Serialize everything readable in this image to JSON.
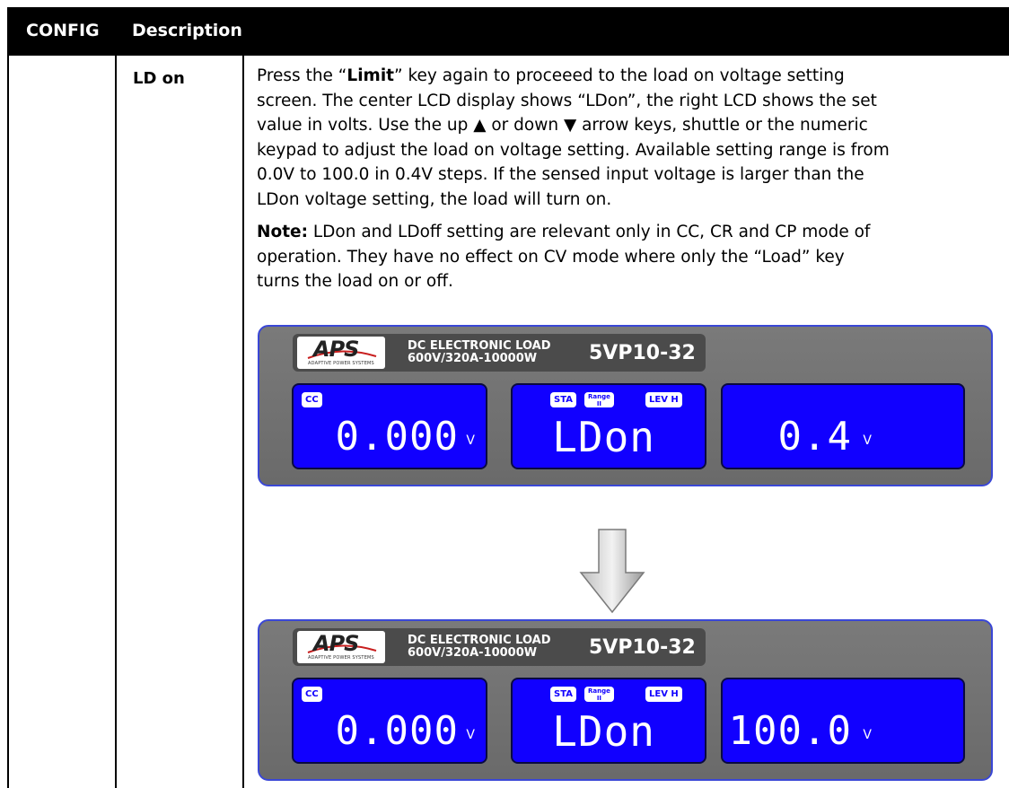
{
  "header": {
    "col1": "CONFIG",
    "col2": "Description"
  },
  "row": {
    "key": "LD on",
    "paragraph1_lines": [
      "Press the “Limit” key again to proceeed to the load on voltage setting",
      "screen. The center LCD display shows “LDon”, the right LCD shows the set",
      "value in volts. Use the up ▲ or down ▼ arrow keys, shuttle or the numeric",
      "keypad  to adjust the load on voltage setting. Available setting range is from",
      "0.0V to 100.0 in 0.4V steps.  If the sensed input voltage is larger than the",
      "LDon voltage setting, the load will turn on."
    ],
    "note_label": "Note:",
    "note_lines": [
      " LDon and LDoff setting are relevant only in CC, CR and CP mode of",
      "operation. They have no effect on CV mode where only the “Load” key",
      "turns the load on or off."
    ]
  },
  "panel_brand": {
    "logo_text": "APS",
    "logo_subtext": "ADAPTIVE POWER SYSTEMS",
    "product_line1": "DC ELECTRONIC LOAD",
    "product_line2": "600V/320A-10000W",
    "model": "5VP10-32"
  },
  "panels": [
    {
      "mode_badge": "CC",
      "left_value": "0.000",
      "left_unit": "V",
      "center_badges": [
        "STA",
        "Range\nII",
        "LEV H"
      ],
      "center_text": "LDon",
      "right_value": "0.4",
      "right_unit": "V"
    },
    {
      "mode_badge": "CC",
      "left_value": "0.000",
      "left_unit": "V",
      "center_badges": [
        "STA",
        "Range\nII",
        "LEV H"
      ],
      "center_text": "LDon",
      "right_value": "100.0",
      "right_unit": "V"
    }
  ],
  "colors": {
    "lcd_blue": "#1100ff",
    "panel_gray": "#727272",
    "panel_border": "#3a47d6",
    "header_bg": "#000000"
  }
}
